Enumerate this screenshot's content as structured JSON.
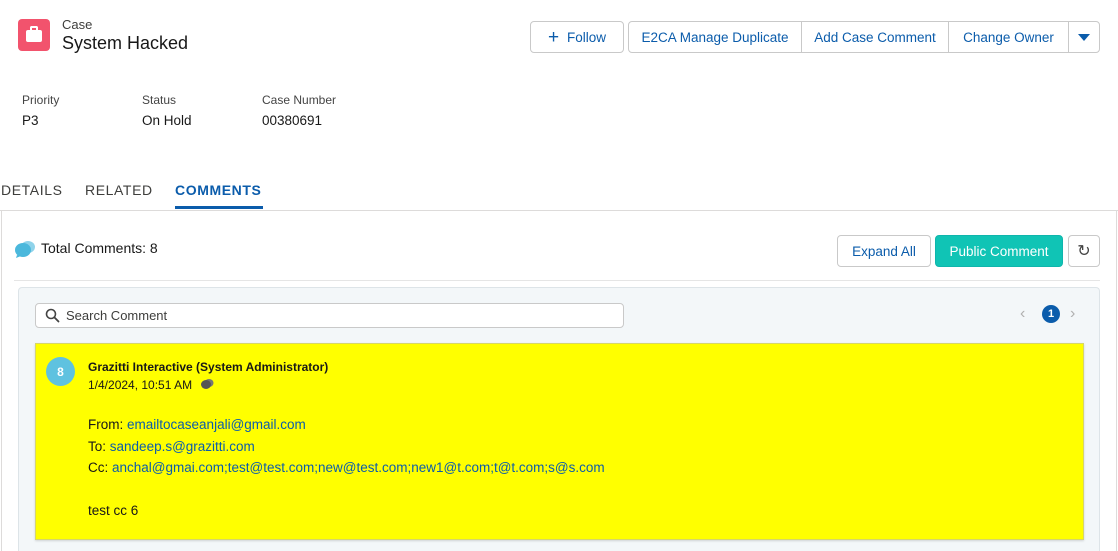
{
  "header": {
    "object_label": "Case",
    "title": "System Hacked",
    "actions": {
      "follow": "Follow",
      "manage_duplicate": "E2CA Manage Duplicate",
      "add_case_comment": "Add Case Comment",
      "change_owner": "Change Owner"
    }
  },
  "fields": [
    {
      "label": "Priority",
      "value": "P3"
    },
    {
      "label": "Status",
      "value": "On Hold"
    },
    {
      "label": "Case Number",
      "value": "00380691"
    }
  ],
  "tabs": [
    {
      "label": "DETAILS",
      "active": false
    },
    {
      "label": "RELATED",
      "active": false
    },
    {
      "label": "COMMENTS",
      "active": true
    }
  ],
  "comments_panel": {
    "total_label": "Total Comments: 8",
    "expand_all": "Expand All",
    "public_comment": "Public Comment",
    "search_placeholder": "Search Comment",
    "search_value": "",
    "current_page": "1"
  },
  "comment": {
    "index": "8",
    "author": "Grazitti Interactive (System Administrator)",
    "date": "1/4/2024, 10:51 AM",
    "from_label": "From:",
    "from_value": "emailtocaseanjali@gmail.com",
    "to_label": "To:",
    "to_value": "sandeep.s@grazitti.com",
    "cc_label": "Cc:",
    "cc_value": "anchal@gmai.com;test@test.com;new@test.com;new1@t.com;t@t.com;s@s.com",
    "body": "test cc 6",
    "highlight_color": "#ffff00"
  },
  "colors": {
    "brand_blue": "#0b5cab",
    "teal_button": "#10c4b5",
    "case_icon": "#f2536d"
  }
}
